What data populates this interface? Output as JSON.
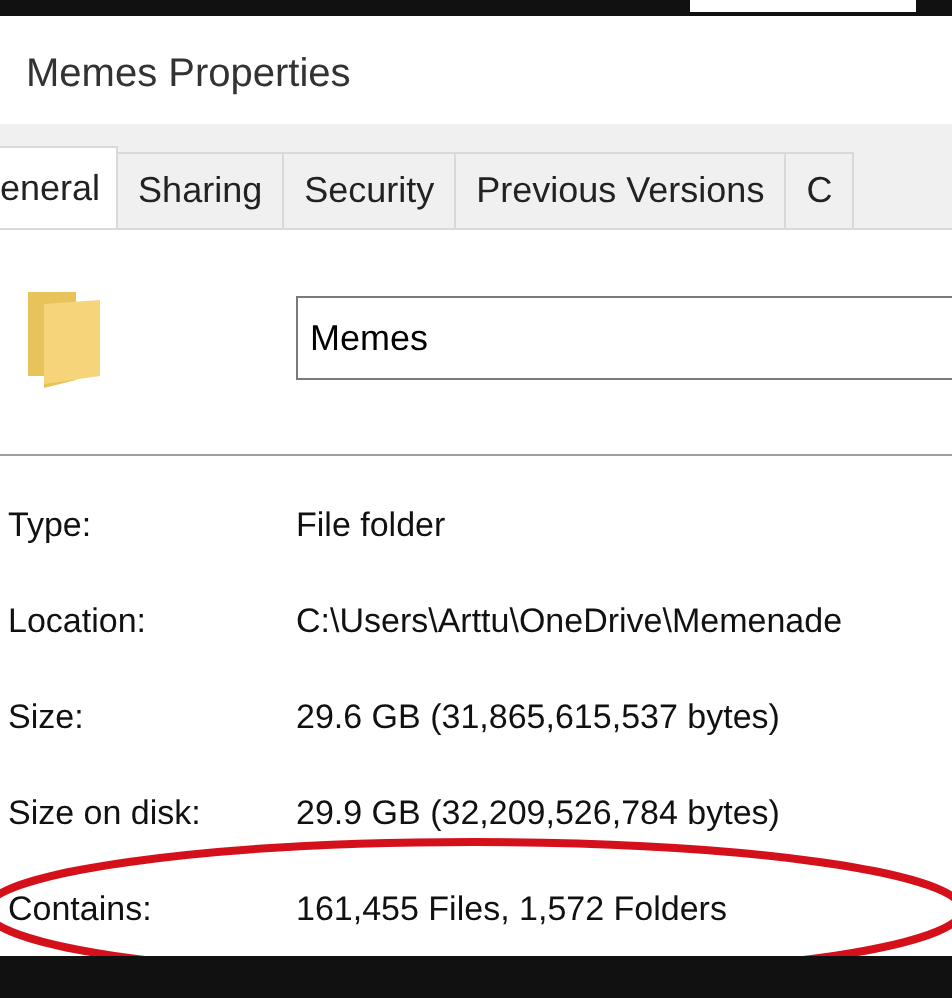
{
  "window": {
    "title": "Memes Properties"
  },
  "tabs": [
    {
      "label": "eneral",
      "selected": true
    },
    {
      "label": "Sharing",
      "selected": false
    },
    {
      "label": "Security",
      "selected": false
    },
    {
      "label": "Previous Versions",
      "selected": false
    },
    {
      "label": "C",
      "selected": false
    }
  ],
  "name_field": {
    "value": "Memes"
  },
  "properties": [
    {
      "label": "Type:",
      "value": "File folder",
      "highlighted": false
    },
    {
      "label": "Location:",
      "value": "C:\\Users\\Arttu\\OneDrive\\Memenade",
      "highlighted": false
    },
    {
      "label": "Size:",
      "value": "29.6 GB (31,865,615,537 bytes)",
      "highlighted": false
    },
    {
      "label": "Size on disk:",
      "value": "29.9 GB (32,209,526,784 bytes)",
      "highlighted": false
    },
    {
      "label": "Contains:",
      "value": "161,455 Files, 1,572 Folders",
      "highlighted": true
    }
  ]
}
